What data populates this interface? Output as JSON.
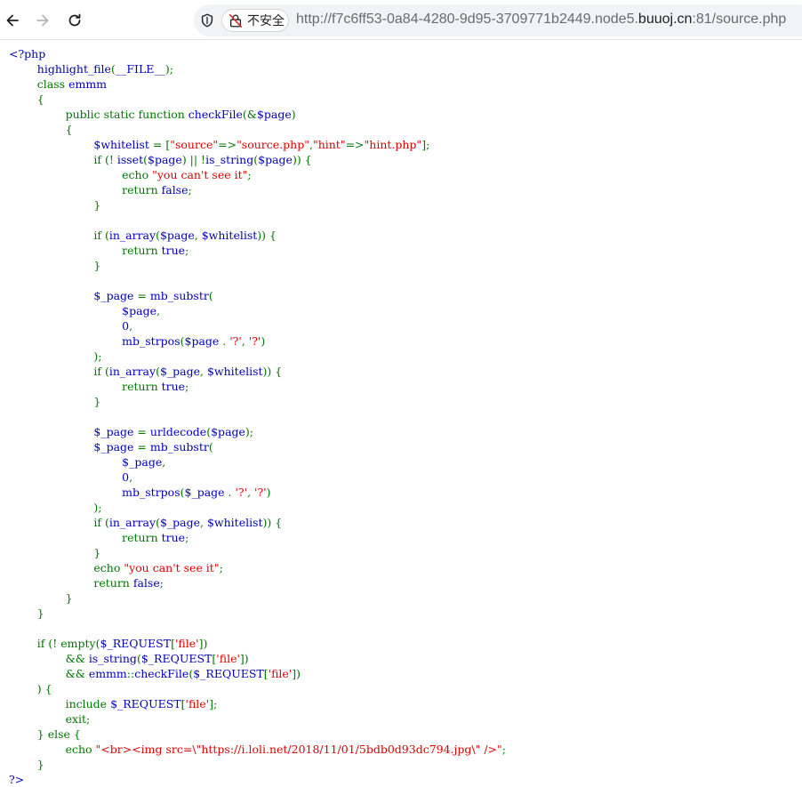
{
  "browser": {
    "back_icon": "arrow-left-icon",
    "forward_icon": "arrow-right-icon",
    "reload_icon": "reload-icon",
    "security_label": "不安全",
    "url_scheme_prefix": "http://f7c6ff53-0a84-4280-9d95-3709771b2449.node5.",
    "url_host": "buuoj.cn",
    "url_suffix": ":81/source.php"
  },
  "colors": {
    "default": "#0000BB",
    "keyword": "#007700",
    "string": "#DD0000",
    "html": "#000000"
  },
  "code_lines": [
    [
      {
        "t": "<?php",
        "c": "default"
      }
    ],
    [
      {
        "t": "        ",
        "c": "default"
      },
      {
        "t": "highlight_file",
        "c": "default"
      },
      {
        "t": "(",
        "c": "keyword"
      },
      {
        "t": "__FILE__",
        "c": "default"
      },
      {
        "t": ");",
        "c": "keyword"
      }
    ],
    [
      {
        "t": "        ",
        "c": "keyword"
      },
      {
        "t": "class ",
        "c": "keyword"
      },
      {
        "t": "emmm",
        "c": "default"
      }
    ],
    [
      {
        "t": "        {",
        "c": "keyword"
      }
    ],
    [
      {
        "t": "                ",
        "c": "keyword"
      },
      {
        "t": "public static function ",
        "c": "keyword"
      },
      {
        "t": "checkFile",
        "c": "default"
      },
      {
        "t": "(&",
        "c": "keyword"
      },
      {
        "t": "$page",
        "c": "default"
      },
      {
        "t": ")",
        "c": "keyword"
      }
    ],
    [
      {
        "t": "                {",
        "c": "keyword"
      }
    ],
    [
      {
        "t": "                        ",
        "c": "keyword"
      },
      {
        "t": "$whitelist ",
        "c": "default"
      },
      {
        "t": "= [",
        "c": "keyword"
      },
      {
        "t": "\"source\"",
        "c": "string"
      },
      {
        "t": "=>",
        "c": "keyword"
      },
      {
        "t": "\"source.php\"",
        "c": "string"
      },
      {
        "t": ",",
        "c": "keyword"
      },
      {
        "t": "\"hint\"",
        "c": "string"
      },
      {
        "t": "=>",
        "c": "keyword"
      },
      {
        "t": "\"hint.php\"",
        "c": "string"
      },
      {
        "t": "];",
        "c": "keyword"
      }
    ],
    [
      {
        "t": "                        ",
        "c": "keyword"
      },
      {
        "t": "if (! ",
        "c": "keyword"
      },
      {
        "t": "isset",
        "c": "default"
      },
      {
        "t": "(",
        "c": "keyword"
      },
      {
        "t": "$page",
        "c": "default"
      },
      {
        "t": ") || !",
        "c": "keyword"
      },
      {
        "t": "is_string",
        "c": "default"
      },
      {
        "t": "(",
        "c": "keyword"
      },
      {
        "t": "$page",
        "c": "default"
      },
      {
        "t": ")) {",
        "c": "keyword"
      }
    ],
    [
      {
        "t": "                                ",
        "c": "keyword"
      },
      {
        "t": "echo ",
        "c": "keyword"
      },
      {
        "t": "\"you can't see it\"",
        "c": "string"
      },
      {
        "t": ";",
        "c": "keyword"
      }
    ],
    [
      {
        "t": "                                ",
        "c": "keyword"
      },
      {
        "t": "return ",
        "c": "keyword"
      },
      {
        "t": "false",
        "c": "default"
      },
      {
        "t": ";",
        "c": "keyword"
      }
    ],
    [
      {
        "t": "                        }",
        "c": "keyword"
      }
    ],
    [
      {
        "t": "",
        "c": "keyword"
      }
    ],
    [
      {
        "t": "                        ",
        "c": "keyword"
      },
      {
        "t": "if (",
        "c": "keyword"
      },
      {
        "t": "in_array",
        "c": "default"
      },
      {
        "t": "(",
        "c": "keyword"
      },
      {
        "t": "$page",
        "c": "default"
      },
      {
        "t": ", ",
        "c": "keyword"
      },
      {
        "t": "$whitelist",
        "c": "default"
      },
      {
        "t": ")) {",
        "c": "keyword"
      }
    ],
    [
      {
        "t": "                                ",
        "c": "keyword"
      },
      {
        "t": "return ",
        "c": "keyword"
      },
      {
        "t": "true",
        "c": "default"
      },
      {
        "t": ";",
        "c": "keyword"
      }
    ],
    [
      {
        "t": "                        }",
        "c": "keyword"
      }
    ],
    [
      {
        "t": "",
        "c": "keyword"
      }
    ],
    [
      {
        "t": "                        ",
        "c": "keyword"
      },
      {
        "t": "$_page ",
        "c": "default"
      },
      {
        "t": "= ",
        "c": "keyword"
      },
      {
        "t": "mb_substr",
        "c": "default"
      },
      {
        "t": "(",
        "c": "keyword"
      }
    ],
    [
      {
        "t": "                                ",
        "c": "keyword"
      },
      {
        "t": "$page",
        "c": "default"
      },
      {
        "t": ",",
        "c": "keyword"
      }
    ],
    [
      {
        "t": "                                ",
        "c": "keyword"
      },
      {
        "t": "0",
        "c": "default"
      },
      {
        "t": ",",
        "c": "keyword"
      }
    ],
    [
      {
        "t": "                                ",
        "c": "keyword"
      },
      {
        "t": "mb_strpos",
        "c": "default"
      },
      {
        "t": "(",
        "c": "keyword"
      },
      {
        "t": "$page ",
        "c": "default"
      },
      {
        "t": ". ",
        "c": "keyword"
      },
      {
        "t": "'?'",
        "c": "string"
      },
      {
        "t": ", ",
        "c": "keyword"
      },
      {
        "t": "'?'",
        "c": "string"
      },
      {
        "t": ")",
        "c": "keyword"
      }
    ],
    [
      {
        "t": "                        );",
        "c": "keyword"
      }
    ],
    [
      {
        "t": "                        ",
        "c": "keyword"
      },
      {
        "t": "if (",
        "c": "keyword"
      },
      {
        "t": "in_array",
        "c": "default"
      },
      {
        "t": "(",
        "c": "keyword"
      },
      {
        "t": "$_page",
        "c": "default"
      },
      {
        "t": ", ",
        "c": "keyword"
      },
      {
        "t": "$whitelist",
        "c": "default"
      },
      {
        "t": ")) {",
        "c": "keyword"
      }
    ],
    [
      {
        "t": "                                ",
        "c": "keyword"
      },
      {
        "t": "return ",
        "c": "keyword"
      },
      {
        "t": "true",
        "c": "default"
      },
      {
        "t": ";",
        "c": "keyword"
      }
    ],
    [
      {
        "t": "                        }",
        "c": "keyword"
      }
    ],
    [
      {
        "t": "",
        "c": "keyword"
      }
    ],
    [
      {
        "t": "                        ",
        "c": "keyword"
      },
      {
        "t": "$_page ",
        "c": "default"
      },
      {
        "t": "= ",
        "c": "keyword"
      },
      {
        "t": "urldecode",
        "c": "default"
      },
      {
        "t": "(",
        "c": "keyword"
      },
      {
        "t": "$page",
        "c": "default"
      },
      {
        "t": ");",
        "c": "keyword"
      }
    ],
    [
      {
        "t": "                        ",
        "c": "keyword"
      },
      {
        "t": "$_page ",
        "c": "default"
      },
      {
        "t": "= ",
        "c": "keyword"
      },
      {
        "t": "mb_substr",
        "c": "default"
      },
      {
        "t": "(",
        "c": "keyword"
      }
    ],
    [
      {
        "t": "                                ",
        "c": "keyword"
      },
      {
        "t": "$_page",
        "c": "default"
      },
      {
        "t": ",",
        "c": "keyword"
      }
    ],
    [
      {
        "t": "                                ",
        "c": "keyword"
      },
      {
        "t": "0",
        "c": "default"
      },
      {
        "t": ",",
        "c": "keyword"
      }
    ],
    [
      {
        "t": "                                ",
        "c": "keyword"
      },
      {
        "t": "mb_strpos",
        "c": "default"
      },
      {
        "t": "(",
        "c": "keyword"
      },
      {
        "t": "$_page ",
        "c": "default"
      },
      {
        "t": ". ",
        "c": "keyword"
      },
      {
        "t": "'?'",
        "c": "string"
      },
      {
        "t": ", ",
        "c": "keyword"
      },
      {
        "t": "'?'",
        "c": "string"
      },
      {
        "t": ")",
        "c": "keyword"
      }
    ],
    [
      {
        "t": "                        );",
        "c": "keyword"
      }
    ],
    [
      {
        "t": "                        ",
        "c": "keyword"
      },
      {
        "t": "if (",
        "c": "keyword"
      },
      {
        "t": "in_array",
        "c": "default"
      },
      {
        "t": "(",
        "c": "keyword"
      },
      {
        "t": "$_page",
        "c": "default"
      },
      {
        "t": ", ",
        "c": "keyword"
      },
      {
        "t": "$whitelist",
        "c": "default"
      },
      {
        "t": ")) {",
        "c": "keyword"
      }
    ],
    [
      {
        "t": "                                ",
        "c": "keyword"
      },
      {
        "t": "return ",
        "c": "keyword"
      },
      {
        "t": "true",
        "c": "default"
      },
      {
        "t": ";",
        "c": "keyword"
      }
    ],
    [
      {
        "t": "                        }",
        "c": "keyword"
      }
    ],
    [
      {
        "t": "                        ",
        "c": "keyword"
      },
      {
        "t": "echo ",
        "c": "keyword"
      },
      {
        "t": "\"you can't see it\"",
        "c": "string"
      },
      {
        "t": ";",
        "c": "keyword"
      }
    ],
    [
      {
        "t": "                        ",
        "c": "keyword"
      },
      {
        "t": "return ",
        "c": "keyword"
      },
      {
        "t": "false",
        "c": "default"
      },
      {
        "t": ";",
        "c": "keyword"
      }
    ],
    [
      {
        "t": "                }",
        "c": "keyword"
      }
    ],
    [
      {
        "t": "        }",
        "c": "keyword"
      }
    ],
    [
      {
        "t": "",
        "c": "keyword"
      }
    ],
    [
      {
        "t": "        ",
        "c": "keyword"
      },
      {
        "t": "if (! ",
        "c": "keyword"
      },
      {
        "t": "empty",
        "c": "keyword"
      },
      {
        "t": "(",
        "c": "keyword"
      },
      {
        "t": "$_REQUEST",
        "c": "default"
      },
      {
        "t": "[",
        "c": "keyword"
      },
      {
        "t": "'file'",
        "c": "string"
      },
      {
        "t": "])",
        "c": "keyword"
      }
    ],
    [
      {
        "t": "                ",
        "c": "keyword"
      },
      {
        "t": "&& ",
        "c": "keyword"
      },
      {
        "t": "is_string",
        "c": "default"
      },
      {
        "t": "(",
        "c": "keyword"
      },
      {
        "t": "$_REQUEST",
        "c": "default"
      },
      {
        "t": "[",
        "c": "keyword"
      },
      {
        "t": "'file'",
        "c": "string"
      },
      {
        "t": "])",
        "c": "keyword"
      }
    ],
    [
      {
        "t": "                ",
        "c": "keyword"
      },
      {
        "t": "&& ",
        "c": "keyword"
      },
      {
        "t": "emmm",
        "c": "default"
      },
      {
        "t": "::",
        "c": "keyword"
      },
      {
        "t": "checkFile",
        "c": "default"
      },
      {
        "t": "(",
        "c": "keyword"
      },
      {
        "t": "$_REQUEST",
        "c": "default"
      },
      {
        "t": "[",
        "c": "keyword"
      },
      {
        "t": "'file'",
        "c": "string"
      },
      {
        "t": "])",
        "c": "keyword"
      }
    ],
    [
      {
        "t": "        ) {",
        "c": "keyword"
      }
    ],
    [
      {
        "t": "                ",
        "c": "keyword"
      },
      {
        "t": "include ",
        "c": "keyword"
      },
      {
        "t": "$_REQUEST",
        "c": "default"
      },
      {
        "t": "[",
        "c": "keyword"
      },
      {
        "t": "'file'",
        "c": "string"
      },
      {
        "t": "];",
        "c": "keyword"
      }
    ],
    [
      {
        "t": "                ",
        "c": "keyword"
      },
      {
        "t": "exit;",
        "c": "keyword"
      }
    ],
    [
      {
        "t": "        } else {",
        "c": "keyword"
      }
    ],
    [
      {
        "t": "                ",
        "c": "keyword"
      },
      {
        "t": "echo ",
        "c": "keyword"
      },
      {
        "t": "\"<br><img src=\\\"https://i.loli.net/2018/11/01/5bdb0d93dc794.jpg\\\" />\"",
        "c": "string"
      },
      {
        "t": ";",
        "c": "keyword"
      }
    ],
    [
      {
        "t": "        }",
        "c": "keyword"
      }
    ],
    [
      {
        "t": "?>",
        "c": "default"
      }
    ]
  ]
}
